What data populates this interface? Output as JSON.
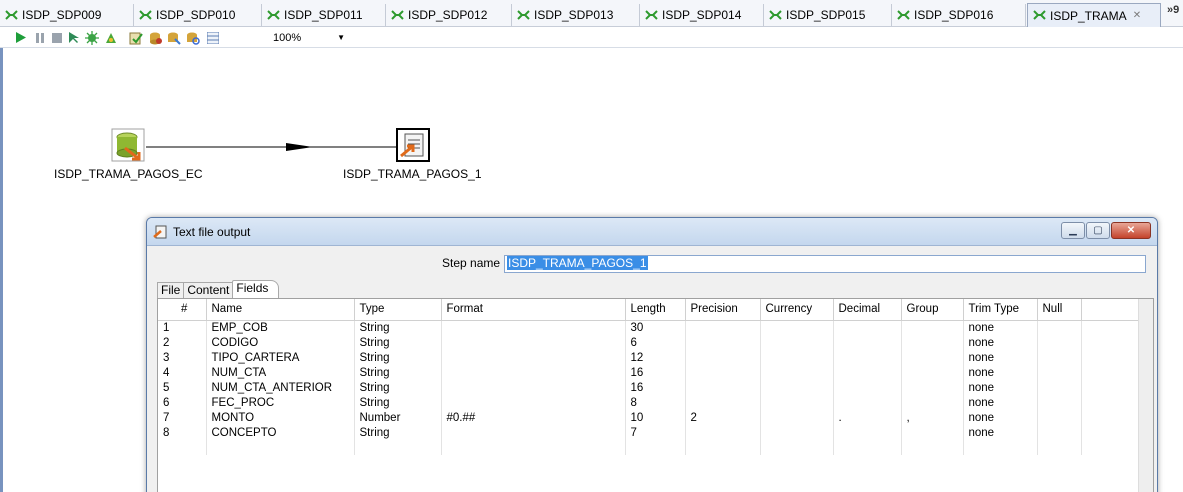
{
  "tabs": [
    {
      "label": "ISDP_SDP009"
    },
    {
      "label": "ISDP_SDP010"
    },
    {
      "label": "ISDP_SDP011"
    },
    {
      "label": "ISDP_SDP012"
    },
    {
      "label": "ISDP_SDP013"
    },
    {
      "label": "ISDP_SDP014"
    },
    {
      "label": "ISDP_SDP015"
    },
    {
      "label": "ISDP_SDP016"
    },
    {
      "label": "ISDP_TRAMA",
      "active": true
    }
  ],
  "tabs_overflow": "»9",
  "toolbar": {
    "zoom": "100%"
  },
  "canvas": {
    "steps": [
      {
        "name": "ISDP_TRAMA_PAGOS_EC",
        "icon": "table-input-icon"
      },
      {
        "name": "ISDP_TRAMA_PAGOS_1",
        "icon": "text-file-output-icon"
      }
    ]
  },
  "dialog": {
    "title": "Text file output",
    "step_name_label": "Step name",
    "step_name_value": "ISDP_TRAMA_PAGOS_1",
    "tabs": [
      "File",
      "Content",
      "Fields"
    ],
    "columns": [
      "#",
      "Name",
      "Type",
      "Format",
      "Length",
      "Precision",
      "Currency",
      "Decimal",
      "Group",
      "Trim Type",
      "Null"
    ],
    "rows": [
      [
        "1",
        "EMP_COB",
        "String",
        "",
        "30",
        "",
        "",
        "",
        "",
        "none",
        ""
      ],
      [
        "2",
        "CODIGO",
        "String",
        "",
        "6",
        "",
        "",
        "",
        "",
        "none",
        ""
      ],
      [
        "3",
        "TIPO_CARTERA",
        "String",
        "",
        "12",
        "",
        "",
        "",
        "",
        "none",
        ""
      ],
      [
        "4",
        "NUM_CTA",
        "String",
        "",
        "16",
        "",
        "",
        "",
        "",
        "none",
        ""
      ],
      [
        "5",
        "NUM_CTA_ANTERIOR",
        "String",
        "",
        "16",
        "",
        "",
        "",
        "",
        "none",
        ""
      ],
      [
        "6",
        "FEC_PROC",
        "String",
        "",
        "8",
        "",
        "",
        "",
        "",
        "none",
        ""
      ],
      [
        "7",
        "MONTO",
        "Number",
        "#0.##",
        "10",
        "2",
        "",
        ".",
        ",",
        "none",
        ""
      ],
      [
        "8",
        "CONCEPTO",
        "String",
        "",
        "7",
        "",
        "",
        "",
        "",
        "none",
        ""
      ]
    ]
  }
}
